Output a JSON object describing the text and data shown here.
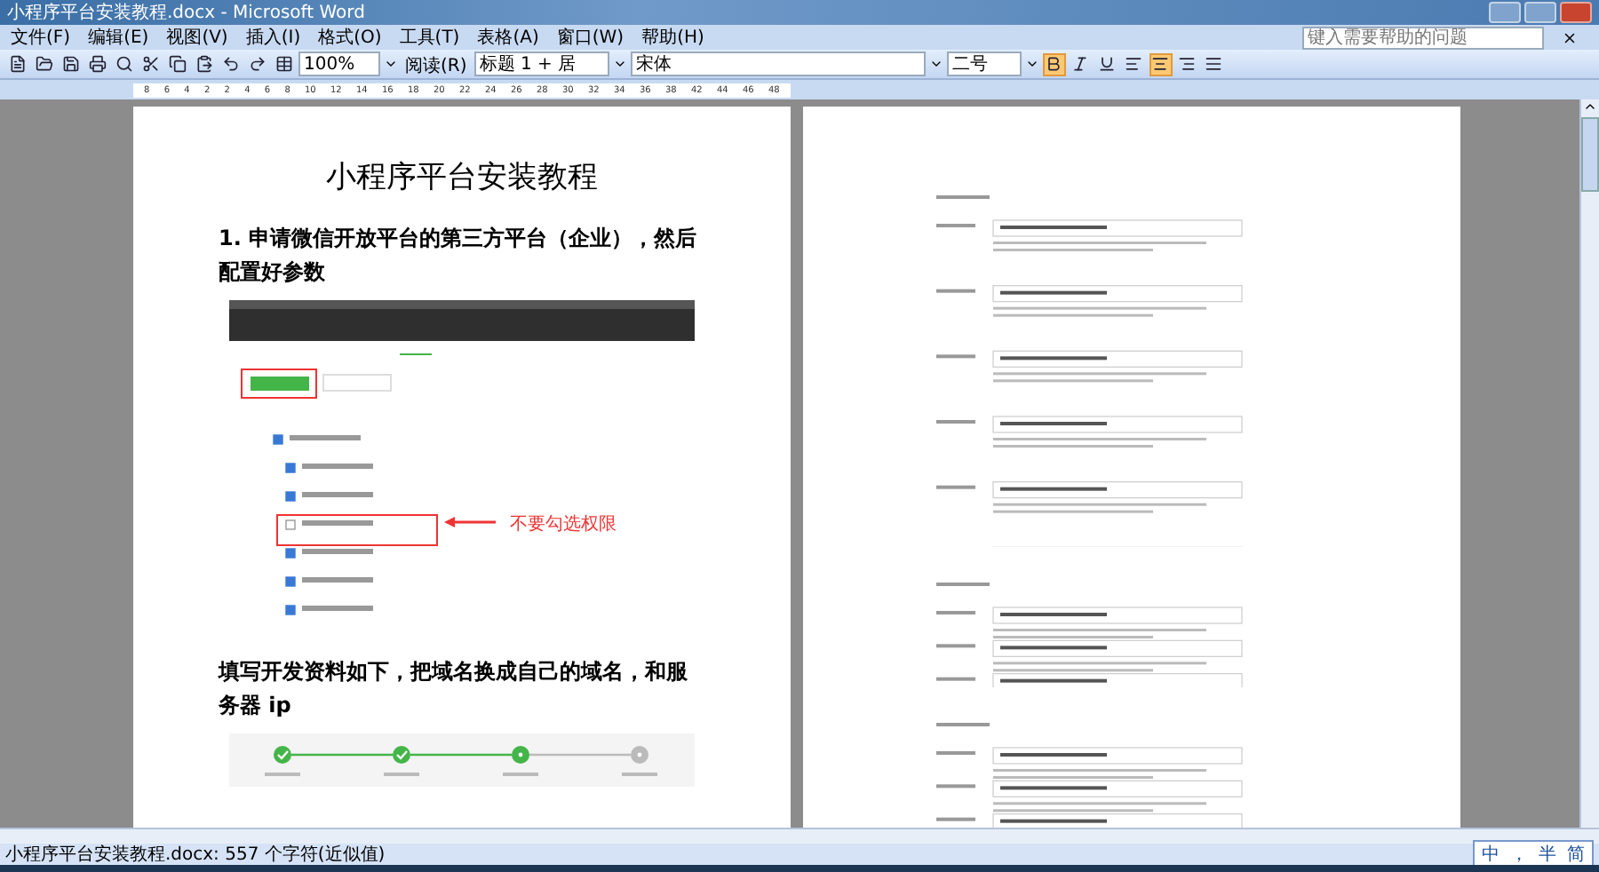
{
  "window": {
    "title": "小程序平台安装教程.docx - Microsoft Word"
  },
  "menu": [
    "文件(F)",
    "编辑(E)",
    "视图(V)",
    "插入(I)",
    "格式(O)",
    "工具(T)",
    "表格(A)",
    "窗口(W)",
    "帮助(H)"
  ],
  "help_box": {
    "placeholder": "键入需要帮助的问题"
  },
  "toolbar": {
    "zoom": "100%",
    "read_button": "阅读(R)",
    "style": "标题 1 + 居",
    "font": "宋体",
    "size": "二号",
    "format_buttons": [
      {
        "kind": "bold",
        "pressed": true
      },
      {
        "kind": "italic",
        "pressed": false
      },
      {
        "kind": "underline",
        "pressed": false
      },
      {
        "kind": "align_left",
        "pressed": false
      },
      {
        "kind": "align_center",
        "pressed": true
      },
      {
        "kind": "align_right",
        "pressed": false
      },
      {
        "kind": "justify",
        "pressed": false
      }
    ]
  },
  "ruler": [
    "8",
    "6",
    "4",
    "2",
    "2",
    "4",
    "6",
    "8",
    "10",
    "12",
    "14",
    "16",
    "18",
    "20",
    "22",
    "24",
    "26",
    "28",
    "30",
    "32",
    "34",
    "36",
    "38",
    "42",
    "44",
    "46",
    "48"
  ],
  "left_page": {
    "title": "小程序平台安装教程",
    "step1": "1. 申请微信开放平台的第三方平台（企业），然后配置好参数",
    "annotation": "不要勾选权限",
    "step2": "填写开发资料如下，把域名换成自己的域名，和服务器 ip",
    "permissions": [
      {
        "checked": true
      },
      {
        "checked": true
      },
      {
        "checked": true
      },
      {
        "checked": false
      },
      {
        "checked": true
      },
      {
        "checked": true
      },
      {
        "checked": true
      }
    ],
    "progress_steps": [
      {
        "kind": "done"
      },
      {
        "kind": "done"
      },
      {
        "kind": "current"
      },
      {
        "kind": "todo"
      }
    ]
  },
  "status_bar": {
    "text": "小程序平台安装教程.docx: 557 个字符(近似值)"
  },
  "ime": [
    "中",
    "，",
    "半",
    "简"
  ]
}
